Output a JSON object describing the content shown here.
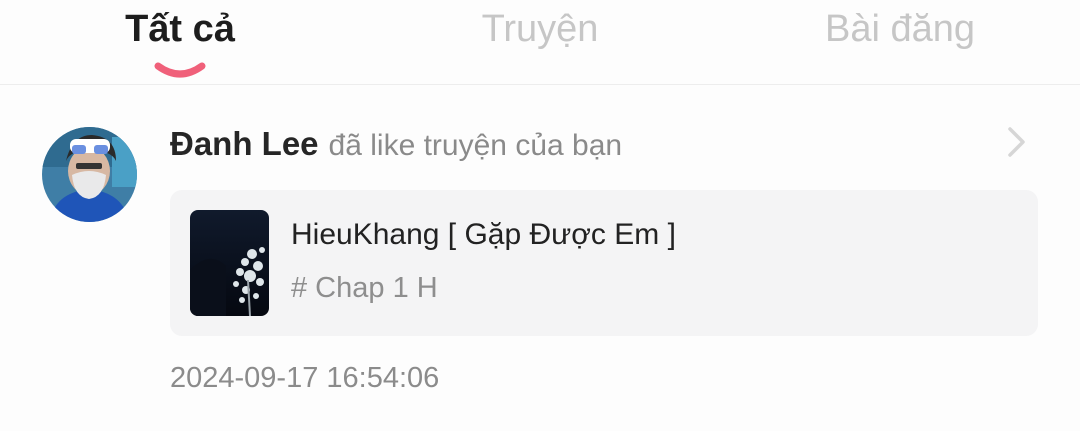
{
  "tabs": [
    {
      "label": "Tất cả",
      "active": true
    },
    {
      "label": "Truyện",
      "active": false
    },
    {
      "label": "Bài đăng",
      "active": false
    }
  ],
  "accent_color": "#f0607a",
  "notification": {
    "user_name": "Đanh Lee",
    "action_text": "đã like truyện của bạn",
    "story": {
      "title": "HieuKhang [ Gặp Được Em ]",
      "chapter": "# Chap 1 H"
    },
    "timestamp": "2024-09-17 16:54:06",
    "icons": {
      "open": "chevron-right-icon"
    }
  }
}
